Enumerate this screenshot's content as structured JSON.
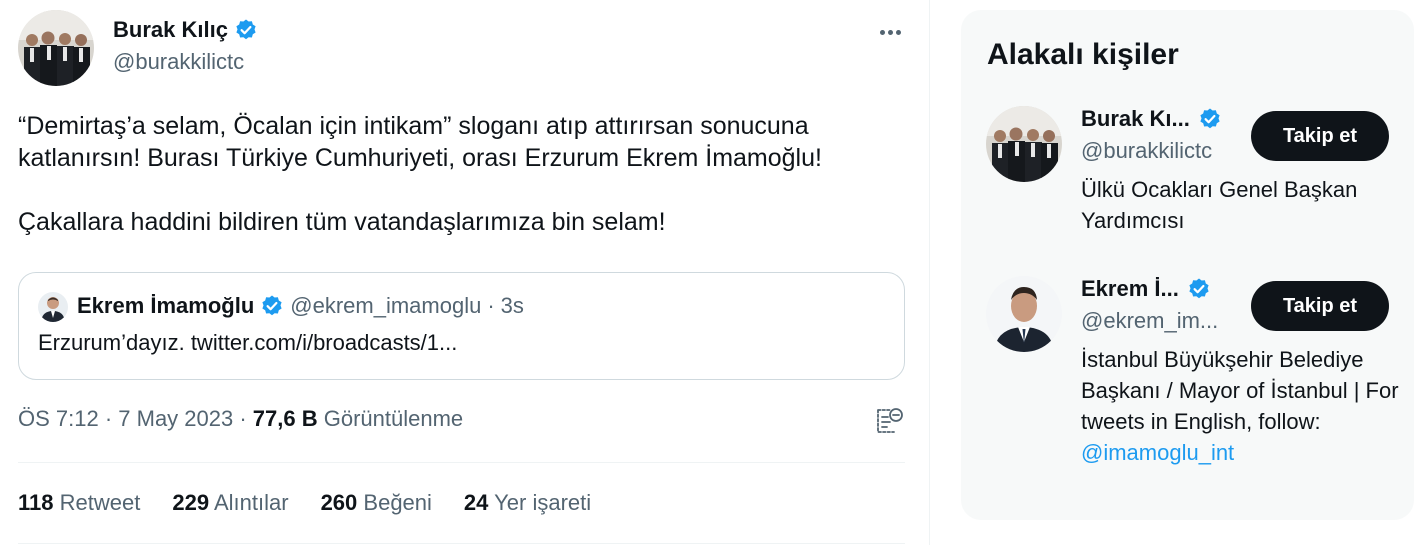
{
  "tweet": {
    "author_name": "Burak Kılıç",
    "author_handle": "@burakkilictc",
    "text_paragraph_1": "“Demirtaş’a selam, Öcalan için intikam” sloganı atıp attırırsan sonucuna\nkatlanırsın! Burası Türkiye Cumhuriyeti, orası Erzurum Ekrem İmamoğlu!",
    "text_paragraph_2": "Çakallara haddini bildiren tüm vatandaşlarımıza bin selam!",
    "quote": {
      "name": "Ekrem İmamoğlu",
      "handle": "@ekrem_imamoglu",
      "separator": "·",
      "time": "3s",
      "text": "Erzurum’dayız. twitter.com/i/broadcasts/1..."
    },
    "timestamp": "ÖS 7:12 · 7 May 2023 ·",
    "views_count": "77,6 B",
    "views_label": "Görüntülenme",
    "stats": [
      {
        "count": "118",
        "label": "Retweet"
      },
      {
        "count": "229",
        "label": "Alıntılar"
      },
      {
        "count": "260",
        "label": "Beğeni"
      },
      {
        "count": "24",
        "label": "Yer işareti"
      }
    ]
  },
  "related": {
    "title": "Alakalı kişiler",
    "people": [
      {
        "name": "Burak Kı...",
        "handle": "@burakkilictc",
        "bio": "Ülkü Ocakları Genel Başkan Yardımcısı",
        "bio_mention": "",
        "follow_label": "Takip et"
      },
      {
        "name": "Ekrem İ...",
        "handle": "@ekrem_im...",
        "bio": "İstanbul Büyükşehir Belediye Başkanı / Mayor of İstanbul | For tweets in English, follow:",
        "bio_mention": "@imamoglu_int",
        "follow_label": "Takip et"
      }
    ]
  },
  "icons": {
    "verified": "verified-badge-icon",
    "more": "more-options-icon",
    "analytics": "analytics-icon"
  },
  "colors": {
    "accent": "#1d9bf0",
    "text": "#0f1419",
    "secondary": "#536471",
    "follow_button": "#0f1419"
  }
}
